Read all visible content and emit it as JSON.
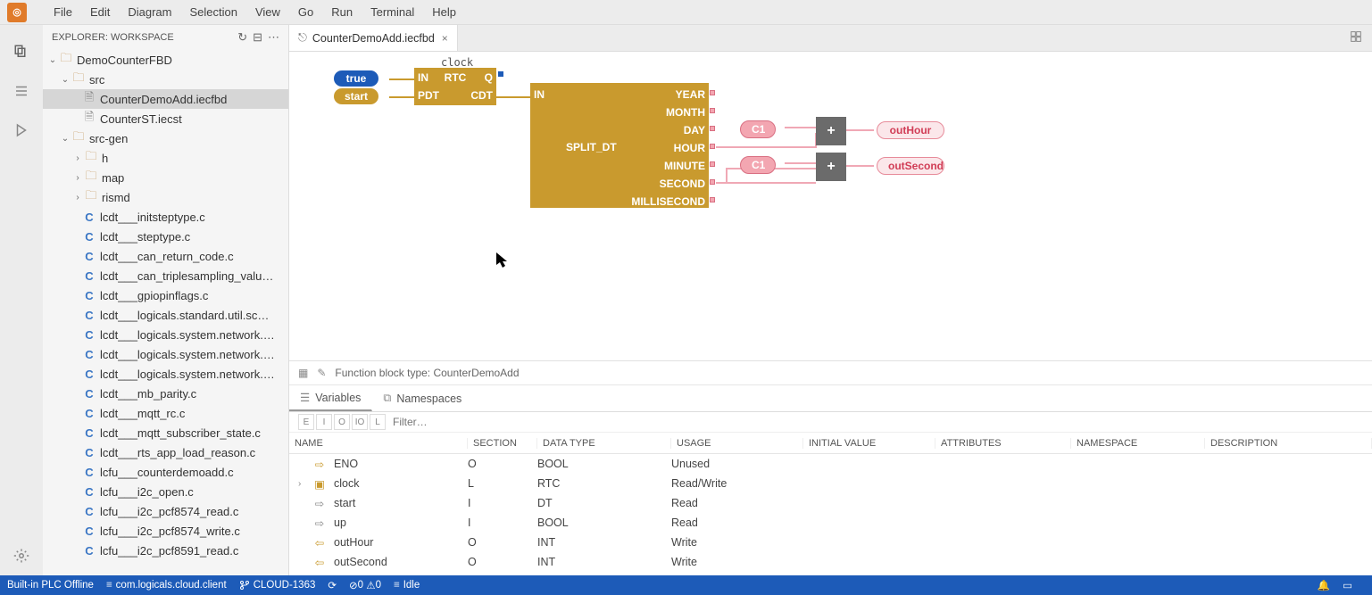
{
  "menu": {
    "items": [
      "File",
      "Edit",
      "Diagram",
      "Selection",
      "View",
      "Go",
      "Run",
      "Terminal",
      "Help"
    ]
  },
  "sidebar": {
    "title": "EXPLORER: WORKSPACE",
    "tree": {
      "root": "DemoCounterFBD",
      "src": "src",
      "file1": "CounterDemoAdd.iecfbd",
      "file2": "CounterST.iecst",
      "srcgen": "src-gen",
      "h": "h",
      "map": "map",
      "rismd": "rismd",
      "cfiles": [
        "lcdt___initsteptype.c",
        "lcdt___steptype.c",
        "lcdt___can_return_code.c",
        "lcdt___can_triplesampling_valu…",
        "lcdt___gpiopinflags.c",
        "lcdt___logicals.standard.util.sc…",
        "lcdt___logicals.system.network.…",
        "lcdt___logicals.system.network.…",
        "lcdt___logicals.system.network.…",
        "lcdt___mb_parity.c",
        "lcdt___mqtt_rc.c",
        "lcdt___mqtt_subscriber_state.c",
        "lcdt___rts_app_load_reason.c",
        "lcfu___counterdemoadd.c",
        "lcfu___i2c_open.c",
        "lcfu___i2c_pcf8574_read.c",
        "lcfu___i2c_pcf8574_write.c",
        "lcfu___i2c_pcf8591_read.c"
      ]
    }
  },
  "tab": {
    "label": "CounterDemoAdd.iecfbd"
  },
  "diagram": {
    "clockLabel": "clock",
    "true": "true",
    "start": "start",
    "rtc": {
      "title": "RTC",
      "in": "IN",
      "q": "Q",
      "pdt": "PDT",
      "cdt": "CDT"
    },
    "split": {
      "title": "SPLIT_DT",
      "in": "IN",
      "out": [
        "YEAR",
        "MONTH",
        "DAY",
        "HOUR",
        "MINUTE",
        "SECOND",
        "MILLISECOND"
      ]
    },
    "c1a": "C1",
    "c1b": "C1",
    "plus": "+",
    "outHour": "outHour",
    "outSecond": "outSecond"
  },
  "panel": {
    "breadcrumb": "Function block type: CounterDemoAdd",
    "tabs": {
      "variables": "Variables",
      "namespaces": "Namespaces"
    },
    "filter": "Filter…",
    "columns": [
      "NAME",
      "SECTION",
      "DATA TYPE",
      "USAGE",
      "INITIAL VALUE",
      "ATTRIBUTES",
      "NAMESPACE",
      "DESCRIPTION"
    ],
    "rows": [
      {
        "name": "ENO",
        "section": "O",
        "datatype": "BOOL",
        "usage": "Unused",
        "icon": "out"
      },
      {
        "name": "clock",
        "section": "L",
        "datatype": "RTC",
        "usage": "Read/Write",
        "icon": "block",
        "expandable": true
      },
      {
        "name": "start",
        "section": "I",
        "datatype": "DT",
        "usage": "Read",
        "icon": "in"
      },
      {
        "name": "up",
        "section": "I",
        "datatype": "BOOL",
        "usage": "Read",
        "icon": "in"
      },
      {
        "name": "outHour",
        "section": "O",
        "datatype": "INT",
        "usage": "Write",
        "icon": "out"
      },
      {
        "name": "outSecond",
        "section": "O",
        "datatype": "INT",
        "usage": "Write",
        "icon": "out"
      }
    ]
  },
  "status": {
    "plc": "Built-in PLC Offline",
    "client": "com.logicals.cloud.client",
    "branch": "CLOUD-1363",
    "sync": "⟳",
    "errors": "0",
    "warnings": "0",
    "idle": "Idle"
  }
}
